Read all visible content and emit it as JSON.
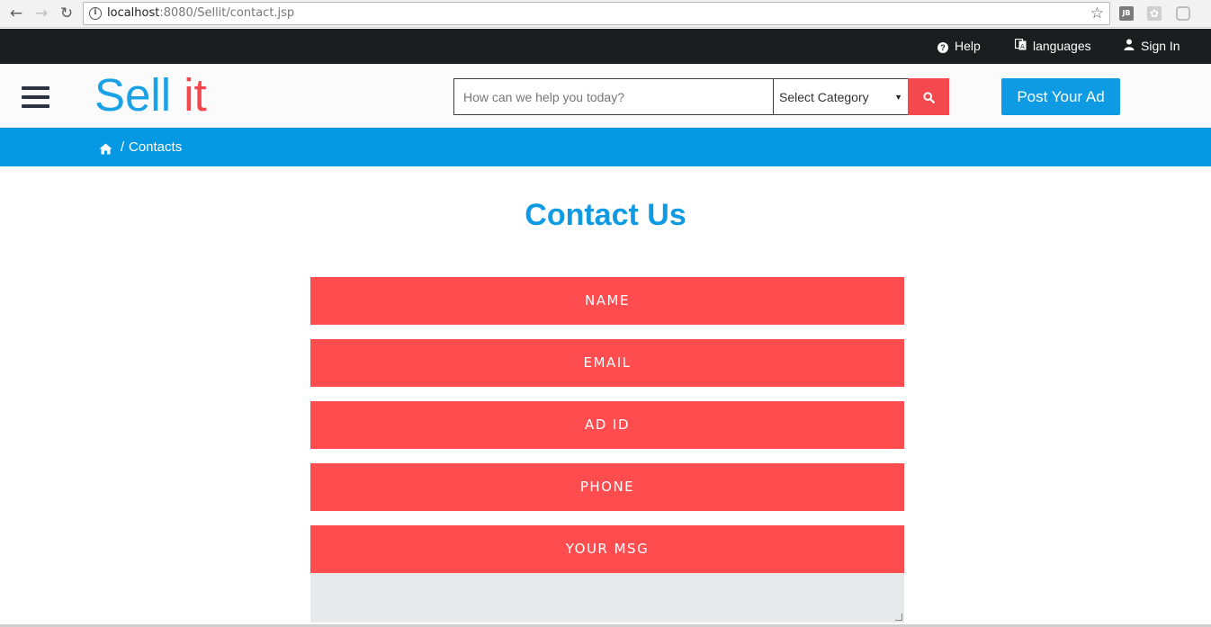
{
  "browser": {
    "url_host": "localhost",
    "url_rest": ":8080/Sellit/contact.jsp"
  },
  "topbar": {
    "help_label": "Help",
    "languages_label": "languages",
    "signin_label": "Sign In"
  },
  "header": {
    "logo_part1": "Sell",
    "logo_part2": "it",
    "search_placeholder": "How can we help you today?",
    "category_selected": "Select Category",
    "post_ad_label": "Post Your Ad"
  },
  "breadcrumb": {
    "separator": "/",
    "current": "Contacts"
  },
  "main": {
    "title": "Contact Us",
    "fields": {
      "name": "NAME",
      "email": "EMAIL",
      "ad_id": "AD ID",
      "phone": "PHONE",
      "message": "YOUR MSG"
    }
  },
  "colors": {
    "brand_blue": "#0f9be3",
    "brand_red": "#ff4c4f",
    "topbar_bg": "#1b1d1f"
  },
  "icons": [
    "back-icon",
    "forward-icon",
    "reload-icon",
    "info-icon",
    "star-icon",
    "help-icon",
    "language-icon",
    "user-icon",
    "hamburger-icon",
    "search-icon",
    "home-icon"
  ]
}
